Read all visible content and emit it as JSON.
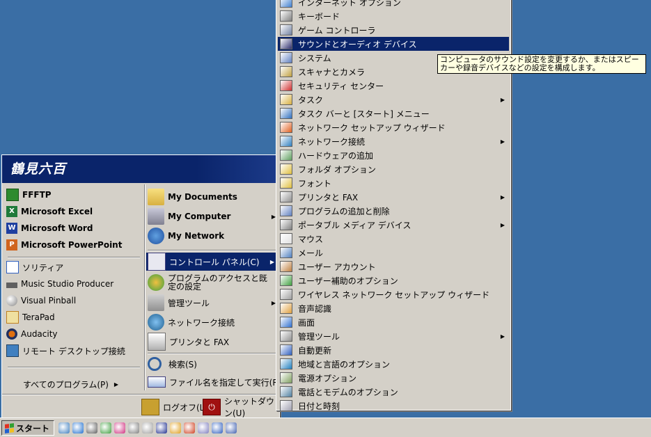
{
  "start_menu": {
    "user_name": "鶴見六百",
    "pinned": [
      {
        "label": "FFFTP",
        "icon": "ffftp-icon",
        "color": "#2e8b2e"
      },
      {
        "label": "Microsoft Excel",
        "icon": "excel-icon",
        "color": "#1f7a3a"
      },
      {
        "label": "Microsoft Word",
        "icon": "word-icon",
        "color": "#1e3fa0"
      },
      {
        "label": "Microsoft PowerPoint",
        "icon": "powerpoint-icon",
        "color": "#d0641e"
      }
    ],
    "recent": [
      {
        "label": "ソリティア",
        "icon": "solitaire-icon",
        "color": "#3060c0"
      },
      {
        "label": "Music Studio Producer",
        "icon": "music-studio-icon",
        "color": "#606060"
      },
      {
        "label": "Visual Pinball",
        "icon": "pinball-icon",
        "color": "#909090"
      },
      {
        "label": "TeraPad",
        "icon": "terapad-icon",
        "color": "#c08020"
      },
      {
        "label": "Audacity",
        "icon": "audacity-icon",
        "color": "#e07010"
      },
      {
        "label": "リモート デスクトップ接続",
        "icon": "remote-desktop-icon",
        "color": "#4080c0"
      }
    ],
    "all_programs": "すべてのプログラム(P)",
    "places": [
      {
        "label": "My Documents",
        "icon": "my-documents-icon"
      },
      {
        "label": "My Computer",
        "icon": "my-computer-icon"
      },
      {
        "label": "My Network",
        "icon": "my-network-icon"
      }
    ],
    "system": [
      {
        "label": "コントロール パネル(C)",
        "icon": "control-panel-icon"
      },
      {
        "label": "プログラムのアクセスと既定の設定",
        "icon": "program-access-icon"
      },
      {
        "label": "管理ツール",
        "icon": "admin-tools-icon"
      },
      {
        "label": "ネットワーク接続",
        "icon": "network-connections-icon"
      },
      {
        "label": "プリンタと FAX",
        "icon": "printers-icon"
      }
    ],
    "search": "検索(S)",
    "run": "ファイル名を指定して実行(R)...",
    "logoff": "ログオフ(L)",
    "shutdown": "シャットダウン(U)"
  },
  "control_panel": {
    "items": [
      {
        "label": "インターネット オプション",
        "icon": "internet-options-icon",
        "arrow": false
      },
      {
        "label": "キーボード",
        "icon": "keyboard-icon",
        "arrow": false
      },
      {
        "label": "ゲーム コントローラ",
        "icon": "game-controller-icon",
        "arrow": false
      },
      {
        "label": "サウンドとオーディオ デバイス",
        "icon": "sound-icon",
        "arrow": false
      },
      {
        "label": "システム",
        "icon": "system-icon",
        "arrow": false
      },
      {
        "label": "スキャナとカメラ",
        "icon": "scanner-icon",
        "arrow": false
      },
      {
        "label": "セキュリティ センター",
        "icon": "security-center-icon",
        "arrow": false
      },
      {
        "label": "タスク",
        "icon": "tasks-icon",
        "arrow": true
      },
      {
        "label": "タスク バーと [スタート] メニュー",
        "icon": "taskbar-icon",
        "arrow": false
      },
      {
        "label": "ネットワーク セットアップ ウィザード",
        "icon": "network-setup-icon",
        "arrow": false
      },
      {
        "label": "ネットワーク接続",
        "icon": "network-conn-icon",
        "arrow": true
      },
      {
        "label": "ハードウェアの追加",
        "icon": "add-hardware-icon",
        "arrow": false
      },
      {
        "label": "フォルダ オプション",
        "icon": "folder-options-icon",
        "arrow": false
      },
      {
        "label": "フォント",
        "icon": "fonts-icon",
        "arrow": false
      },
      {
        "label": "プリンタと FAX",
        "icon": "printer-fax-icon",
        "arrow": true
      },
      {
        "label": "プログラムの追加と削除",
        "icon": "add-remove-icon",
        "arrow": false
      },
      {
        "label": "ポータブル メディア デバイス",
        "icon": "portable-media-icon",
        "arrow": true
      },
      {
        "label": "マウス",
        "icon": "mouse-icon",
        "arrow": false
      },
      {
        "label": "メール",
        "icon": "mail-icon",
        "arrow": false
      },
      {
        "label": "ユーザー アカウント",
        "icon": "user-accounts-icon",
        "arrow": false
      },
      {
        "label": "ユーザー補助のオプション",
        "icon": "accessibility-icon",
        "arrow": false
      },
      {
        "label": "ワイヤレス ネットワーク セットアップ ウィザード",
        "icon": "wireless-icon",
        "arrow": false
      },
      {
        "label": "音声認識",
        "icon": "speech-icon",
        "arrow": false
      },
      {
        "label": "画面",
        "icon": "display-icon",
        "arrow": false
      },
      {
        "label": "管理ツール",
        "icon": "cp-admin-tools-icon",
        "arrow": true
      },
      {
        "label": "自動更新",
        "icon": "auto-update-icon",
        "arrow": false
      },
      {
        "label": "地域と言語のオプション",
        "icon": "region-icon",
        "arrow": false
      },
      {
        "label": "電源オプション",
        "icon": "power-icon",
        "arrow": false
      },
      {
        "label": "電話とモデムのオプション",
        "icon": "phone-modem-icon",
        "arrow": false
      },
      {
        "label": "日付と時刻",
        "icon": "date-time-icon",
        "arrow": false
      }
    ],
    "selected_index": 3
  },
  "tooltip": "コンピュータのサウンド設定を変更するか、またはスピーカーや録音デバイスなどの設定を構成します。",
  "taskbar": {
    "start_label": "スタート",
    "quick_launch": [
      "quick-launch-1-icon",
      "ie-icon",
      "quick-launch-3-icon",
      "quick-launch-4-icon",
      "quick-launch-5-icon",
      "quick-launch-6-icon",
      "quick-launch-7-icon",
      "quick-launch-8-icon",
      "quick-launch-9-icon",
      "quick-launch-10-icon",
      "quick-launch-11-icon",
      "quick-launch-12-icon",
      "quick-launch-13-icon"
    ]
  }
}
